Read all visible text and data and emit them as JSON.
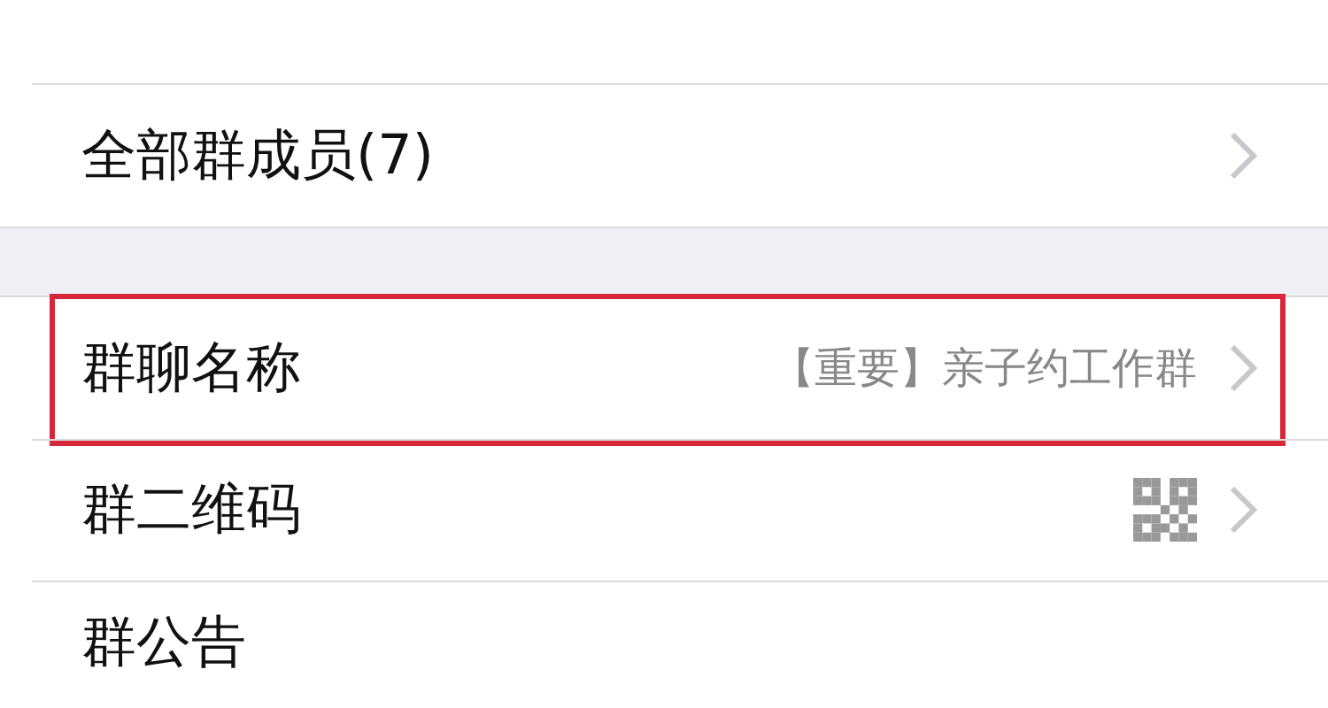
{
  "sections": [
    {
      "items": [
        {
          "kind": "plain",
          "label": "全部群成员(7)",
          "highlighted": false
        }
      ]
    },
    {
      "items": [
        {
          "kind": "text",
          "label": "群聊名称",
          "value": "【重要】亲子约工作群",
          "highlighted": true
        },
        {
          "kind": "qrcode",
          "label": "群二维码",
          "highlighted": false
        },
        {
          "kind": "plain",
          "label": "群公告",
          "highlighted": false,
          "chevron": false
        }
      ]
    }
  ]
}
